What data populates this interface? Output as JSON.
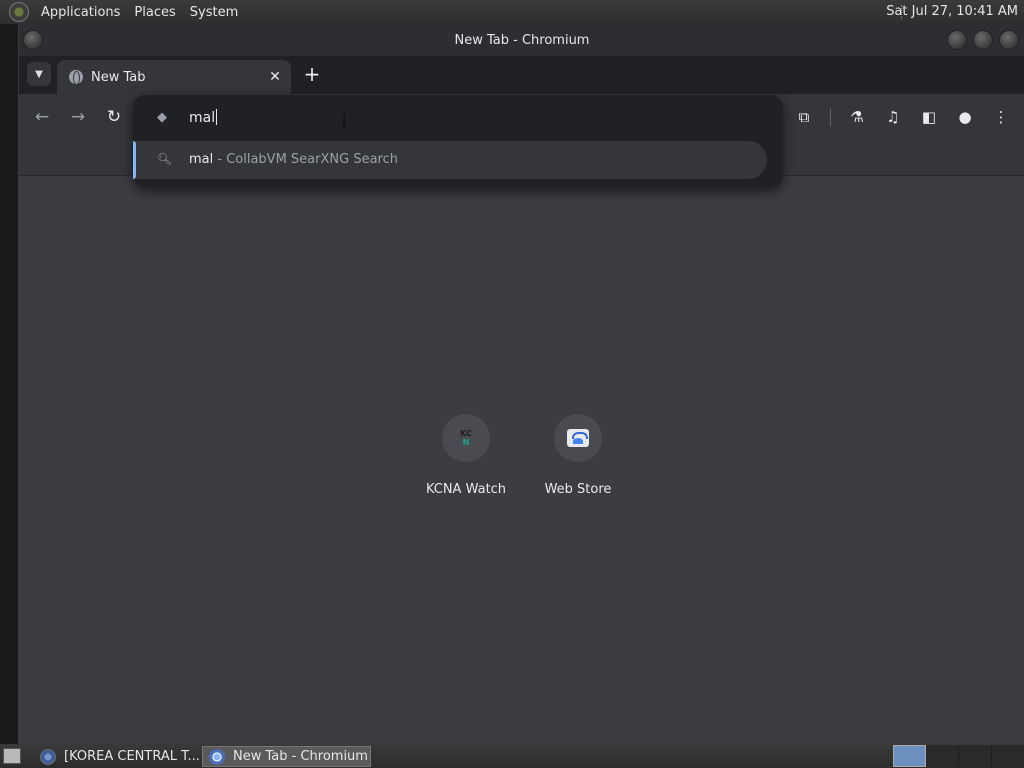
{
  "top_panel": {
    "menus": [
      "Applications",
      "Places",
      "System"
    ],
    "clock": "Sat Jul 27, 10:41 AM"
  },
  "window": {
    "title": "New Tab - Chromium"
  },
  "tabs": [
    {
      "title": "New Tab",
      "icon": "globe-icon"
    }
  ],
  "omnibox": {
    "value": "mal",
    "suggestion": {
      "query": "mal",
      "description": " - CollabVM SearXNG Search"
    }
  },
  "shortcuts": [
    {
      "label": "KCNA Watch",
      "icon": "kcna-watch-logo"
    },
    {
      "label": "Web Store",
      "icon": "web-store-logo"
    }
  ],
  "taskbar": {
    "tasks": [
      {
        "label": "[KOREA CENTRAL T...",
        "active": false
      },
      {
        "label": "New Tab - Chromium",
        "active": true
      }
    ]
  },
  "colors": {
    "accent": "#8ab4f8",
    "ntp_background": "#3c3c41",
    "toolbar": "#35363a",
    "tabstrip": "#202124"
  }
}
